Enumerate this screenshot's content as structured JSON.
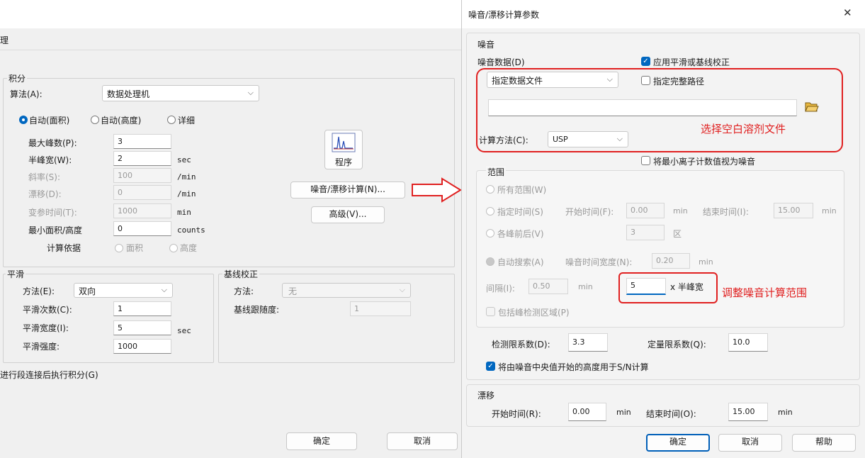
{
  "left_dialog": {
    "title_fragment": "理",
    "integration": {
      "group_label": "积分",
      "algorithm_label": "算法(A):",
      "algorithm_value": "数据处理机",
      "modes": [
        "自动(面积)",
        "自动(高度)",
        "详细"
      ],
      "params": [
        {
          "label": "最大峰数(P):",
          "value": "3",
          "unit": ""
        },
        {
          "label": "半峰宽(W):",
          "value": "2",
          "unit": "sec"
        },
        {
          "label": "斜率(S):",
          "value": "100",
          "unit": "/min"
        },
        {
          "label": "漂移(D):",
          "value": "0",
          "unit": "/min"
        },
        {
          "label": "变参时间(T):",
          "value": "1000",
          "unit": "min"
        },
        {
          "label": "最小面积/高度",
          "value": "0",
          "unit": "counts"
        }
      ],
      "basis_label": "计算依据",
      "basis_options": [
        "面积",
        "高度"
      ],
      "program_button": "程序",
      "noise_drift_button": "噪音/漂移计算(N)...",
      "advanced_button": "高级(V)..."
    },
    "smoothing": {
      "group_label": "平滑",
      "method_label": "方法(E):",
      "method_value": "双向",
      "count_label": "平滑次数(C):",
      "count_value": "1",
      "width_label": "平滑宽度(I):",
      "width_value": "5",
      "width_unit": "sec",
      "strength_label": "平滑强度:",
      "strength_value": "1000"
    },
    "baseline": {
      "group_label": "基线校正",
      "method_label": "方法:",
      "method_value": "无",
      "tracking_label": "基线跟随度:",
      "tracking_value": "1"
    },
    "bottom_text": "进行段连接后执行积分(G)",
    "ok_button": "确定",
    "cancel_button": "取消"
  },
  "right_dialog": {
    "title": "噪音/漂移计算参数",
    "close_glyph": "✕",
    "noise": {
      "section_label": "噪音",
      "data_label": "噪音数据(D)",
      "apply_smoothing_label": "应用平滑或基线校正",
      "apply_smoothing_checked": true,
      "data_select_value": "指定数据文件",
      "full_path_label": "指定完整路径",
      "full_path_checked": false,
      "path_value": "",
      "calc_method_label": "计算方法(C):",
      "calc_method_value": "USP",
      "min_ion_label": "将最小离子计数值视为噪音",
      "min_ion_checked": false
    },
    "range": {
      "group_label": "范围",
      "all_range": "所有范围(W)",
      "specified_time": "指定时间(S)",
      "start_time_label": "开始时间(F):",
      "start_time_value": "0.00",
      "start_time_unit": "min",
      "end_time_label": "结束时间(I):",
      "end_time_value": "15.00",
      "end_time_unit": "min",
      "each_peak": "各峰前后(V)",
      "each_peak_value": "3",
      "each_peak_unit": "区",
      "auto_search": "自动搜索(A)",
      "noise_width_label": "噪音时间宽度(N):",
      "noise_width_value": "0.20",
      "noise_width_unit": "min",
      "interval_label": "间隔(I):",
      "interval_value": "0.50",
      "interval_unit": "min",
      "half_width_value": "5",
      "half_width_unit": "x 半峰宽",
      "include_peak_label": "包括峰检测区域(P)"
    },
    "limits": {
      "detection_label": "检测限系数(D):",
      "detection_value": "3.3",
      "quant_label": "定量限系数(Q):",
      "quant_value": "10.0",
      "median_label": "将由噪音中央值开始的高度用于S/N计算",
      "median_checked": true
    },
    "drift": {
      "section_label": "漂移",
      "start_label": "开始时间(R):",
      "start_value": "0.00",
      "start_unit": "min",
      "end_label": "结束时间(O):",
      "end_value": "15.00",
      "end_unit": "min"
    },
    "ok_button": "确定",
    "cancel_button": "取消",
    "help_button": "帮助"
  },
  "annotations": {
    "blank_solvent": "选择空白溶剂文件",
    "adjust_range": "调整噪音计算范围",
    "accent_color": "#e02020"
  }
}
